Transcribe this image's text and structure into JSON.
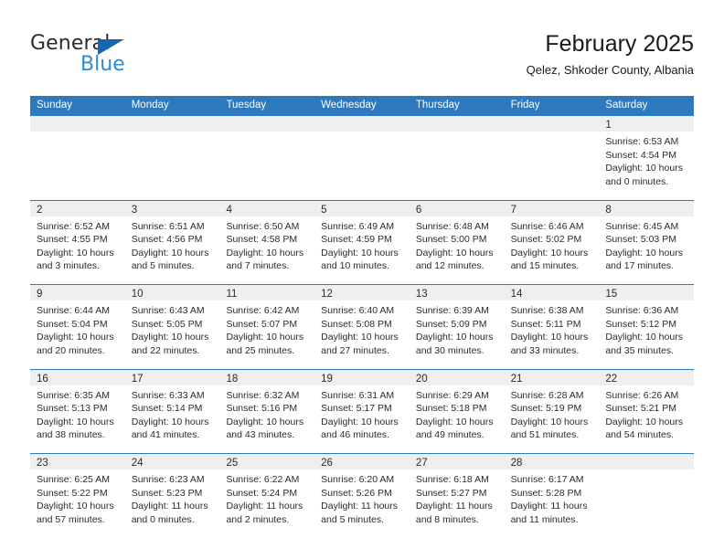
{
  "brand": {
    "name_part1": "General",
    "name_part2": "Blue",
    "accent_color": "#2e8bd6",
    "triangle_color": "#1567b0"
  },
  "header": {
    "title": "February 2025",
    "subtitle": "Qelez, Shkoder County, Albania"
  },
  "theme": {
    "header_row_color": "#2E79BD",
    "day_band_color": "#EFEFEF",
    "text_color": "#2b2b2b"
  },
  "weekdays": [
    "Sunday",
    "Monday",
    "Tuesday",
    "Wednesday",
    "Thursday",
    "Friday",
    "Saturday"
  ],
  "weeks": [
    [
      {
        "empty": true
      },
      {
        "empty": true
      },
      {
        "empty": true
      },
      {
        "empty": true
      },
      {
        "empty": true
      },
      {
        "empty": true
      },
      {
        "day": "1",
        "sunrise": "Sunrise: 6:53 AM",
        "sunset": "Sunset: 4:54 PM",
        "daylight1": "Daylight: 10 hours",
        "daylight2": "and 0 minutes."
      }
    ],
    [
      {
        "day": "2",
        "sunrise": "Sunrise: 6:52 AM",
        "sunset": "Sunset: 4:55 PM",
        "daylight1": "Daylight: 10 hours",
        "daylight2": "and 3 minutes."
      },
      {
        "day": "3",
        "sunrise": "Sunrise: 6:51 AM",
        "sunset": "Sunset: 4:56 PM",
        "daylight1": "Daylight: 10 hours",
        "daylight2": "and 5 minutes."
      },
      {
        "day": "4",
        "sunrise": "Sunrise: 6:50 AM",
        "sunset": "Sunset: 4:58 PM",
        "daylight1": "Daylight: 10 hours",
        "daylight2": "and 7 minutes."
      },
      {
        "day": "5",
        "sunrise": "Sunrise: 6:49 AM",
        "sunset": "Sunset: 4:59 PM",
        "daylight1": "Daylight: 10 hours",
        "daylight2": "and 10 minutes."
      },
      {
        "day": "6",
        "sunrise": "Sunrise: 6:48 AM",
        "sunset": "Sunset: 5:00 PM",
        "daylight1": "Daylight: 10 hours",
        "daylight2": "and 12 minutes."
      },
      {
        "day": "7",
        "sunrise": "Sunrise: 6:46 AM",
        "sunset": "Sunset: 5:02 PM",
        "daylight1": "Daylight: 10 hours",
        "daylight2": "and 15 minutes."
      },
      {
        "day": "8",
        "sunrise": "Sunrise: 6:45 AM",
        "sunset": "Sunset: 5:03 PM",
        "daylight1": "Daylight: 10 hours",
        "daylight2": "and 17 minutes."
      }
    ],
    [
      {
        "day": "9",
        "sunrise": "Sunrise: 6:44 AM",
        "sunset": "Sunset: 5:04 PM",
        "daylight1": "Daylight: 10 hours",
        "daylight2": "and 20 minutes."
      },
      {
        "day": "10",
        "sunrise": "Sunrise: 6:43 AM",
        "sunset": "Sunset: 5:05 PM",
        "daylight1": "Daylight: 10 hours",
        "daylight2": "and 22 minutes."
      },
      {
        "day": "11",
        "sunrise": "Sunrise: 6:42 AM",
        "sunset": "Sunset: 5:07 PM",
        "daylight1": "Daylight: 10 hours",
        "daylight2": "and 25 minutes."
      },
      {
        "day": "12",
        "sunrise": "Sunrise: 6:40 AM",
        "sunset": "Sunset: 5:08 PM",
        "daylight1": "Daylight: 10 hours",
        "daylight2": "and 27 minutes."
      },
      {
        "day": "13",
        "sunrise": "Sunrise: 6:39 AM",
        "sunset": "Sunset: 5:09 PM",
        "daylight1": "Daylight: 10 hours",
        "daylight2": "and 30 minutes."
      },
      {
        "day": "14",
        "sunrise": "Sunrise: 6:38 AM",
        "sunset": "Sunset: 5:11 PM",
        "daylight1": "Daylight: 10 hours",
        "daylight2": "and 33 minutes."
      },
      {
        "day": "15",
        "sunrise": "Sunrise: 6:36 AM",
        "sunset": "Sunset: 5:12 PM",
        "daylight1": "Daylight: 10 hours",
        "daylight2": "and 35 minutes."
      }
    ],
    [
      {
        "day": "16",
        "sunrise": "Sunrise: 6:35 AM",
        "sunset": "Sunset: 5:13 PM",
        "daylight1": "Daylight: 10 hours",
        "daylight2": "and 38 minutes."
      },
      {
        "day": "17",
        "sunrise": "Sunrise: 6:33 AM",
        "sunset": "Sunset: 5:14 PM",
        "daylight1": "Daylight: 10 hours",
        "daylight2": "and 41 minutes."
      },
      {
        "day": "18",
        "sunrise": "Sunrise: 6:32 AM",
        "sunset": "Sunset: 5:16 PM",
        "daylight1": "Daylight: 10 hours",
        "daylight2": "and 43 minutes."
      },
      {
        "day": "19",
        "sunrise": "Sunrise: 6:31 AM",
        "sunset": "Sunset: 5:17 PM",
        "daylight1": "Daylight: 10 hours",
        "daylight2": "and 46 minutes."
      },
      {
        "day": "20",
        "sunrise": "Sunrise: 6:29 AM",
        "sunset": "Sunset: 5:18 PM",
        "daylight1": "Daylight: 10 hours",
        "daylight2": "and 49 minutes."
      },
      {
        "day": "21",
        "sunrise": "Sunrise: 6:28 AM",
        "sunset": "Sunset: 5:19 PM",
        "daylight1": "Daylight: 10 hours",
        "daylight2": "and 51 minutes."
      },
      {
        "day": "22",
        "sunrise": "Sunrise: 6:26 AM",
        "sunset": "Sunset: 5:21 PM",
        "daylight1": "Daylight: 10 hours",
        "daylight2": "and 54 minutes."
      }
    ],
    [
      {
        "day": "23",
        "sunrise": "Sunrise: 6:25 AM",
        "sunset": "Sunset: 5:22 PM",
        "daylight1": "Daylight: 10 hours",
        "daylight2": "and 57 minutes."
      },
      {
        "day": "24",
        "sunrise": "Sunrise: 6:23 AM",
        "sunset": "Sunset: 5:23 PM",
        "daylight1": "Daylight: 11 hours",
        "daylight2": "and 0 minutes."
      },
      {
        "day": "25",
        "sunrise": "Sunrise: 6:22 AM",
        "sunset": "Sunset: 5:24 PM",
        "daylight1": "Daylight: 11 hours",
        "daylight2": "and 2 minutes."
      },
      {
        "day": "26",
        "sunrise": "Sunrise: 6:20 AM",
        "sunset": "Sunset: 5:26 PM",
        "daylight1": "Daylight: 11 hours",
        "daylight2": "and 5 minutes."
      },
      {
        "day": "27",
        "sunrise": "Sunrise: 6:18 AM",
        "sunset": "Sunset: 5:27 PM",
        "daylight1": "Daylight: 11 hours",
        "daylight2": "and 8 minutes."
      },
      {
        "day": "28",
        "sunrise": "Sunrise: 6:17 AM",
        "sunset": "Sunset: 5:28 PM",
        "daylight1": "Daylight: 11 hours",
        "daylight2": "and 11 minutes."
      },
      {
        "empty": true
      }
    ]
  ]
}
